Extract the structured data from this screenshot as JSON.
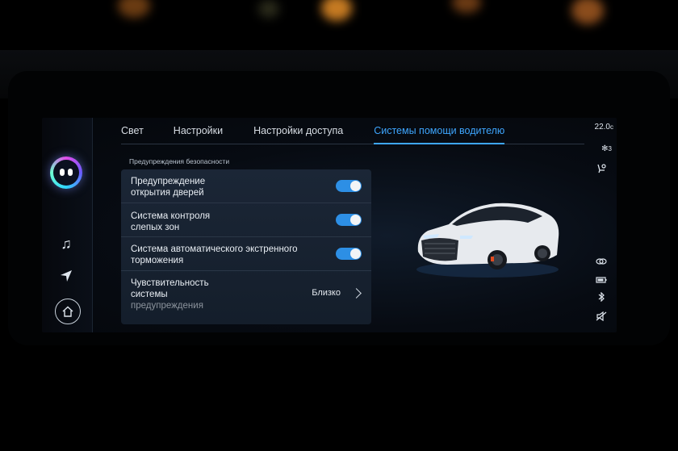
{
  "tabs": [
    {
      "label": "Свет",
      "active": false
    },
    {
      "label": "Настройки",
      "active": false
    },
    {
      "label": "Настройки доступа",
      "active": false
    },
    {
      "label": "Системы помощи водителю",
      "active": true
    }
  ],
  "section_title": "Предупреждения безопасности",
  "rows": [
    {
      "label_line1": "Предупреждение",
      "label_line2": "открытия дверей",
      "toggle": true
    },
    {
      "label_line1": "Система контроля",
      "label_line2": "слепых зон",
      "toggle": true
    },
    {
      "label_line1": "Система автоматического экстренного",
      "label_line2": "торможения",
      "toggle": true
    },
    {
      "label_line1": "Чувствительность",
      "label_line2": "системы",
      "label_line3": "предупреждения",
      "value": "Близко"
    }
  ],
  "status": {
    "temperature": "22.0",
    "temperature_unit": "c",
    "fan_level": "3"
  },
  "dock": {
    "icons": [
      "assistant-avatar",
      "music-icon",
      "navigation-icon",
      "home-icon"
    ]
  },
  "colors": {
    "accent": "#3ea6ff",
    "toggle_on": "#2d8fe5"
  }
}
